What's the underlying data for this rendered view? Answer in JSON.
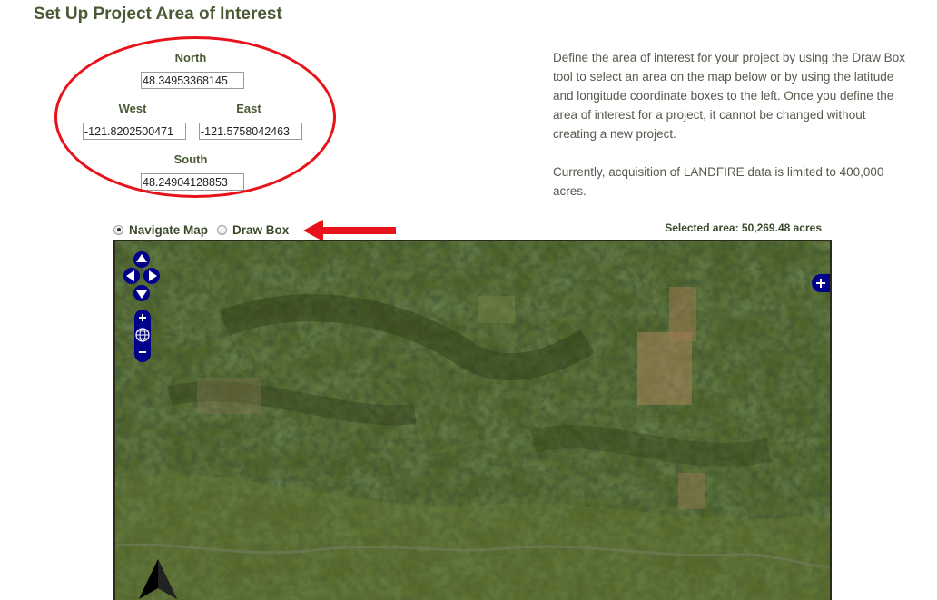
{
  "page": {
    "title": "Set Up Project Area of Interest"
  },
  "coordinates": {
    "north_label": "North",
    "north_value": "48.34953368145",
    "west_label": "West",
    "west_value": "-121.8202500471",
    "east_label": "East",
    "east_value": "-121.5758042463",
    "south_label": "South",
    "south_value": "48.24904128853"
  },
  "description": {
    "paragraph1": "Define the area of interest for your project by using the Draw Box tool to select an area on the map below or by using the latitude and longitude coordinate boxes to the left. Once you define the area of interest for a project, it cannot be changed without creating a new project.",
    "paragraph2": "Currently, acquisition of LANDFIRE data is limited to 400,000 acres."
  },
  "map_mode": {
    "navigate_label": "Navigate Map",
    "draw_label": "Draw Box",
    "selected": "Navigate Map"
  },
  "selected_area": "Selected area: 50,269.48 acres",
  "annotation": {
    "ellipse_color": "#e8121b",
    "arrow_color": "#e8121b"
  },
  "map": {
    "icons": [
      "pan-up-icon",
      "pan-left-icon",
      "pan-right-icon",
      "pan-down-icon",
      "zoom-in-icon",
      "zoom-world-icon",
      "zoom-out-icon",
      "layer-switcher-icon",
      "north-arrow-icon"
    ],
    "control_color": "#00008b"
  }
}
